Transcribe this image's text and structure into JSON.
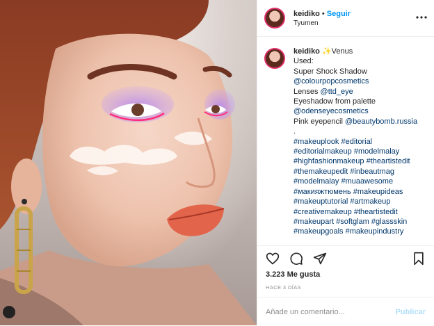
{
  "post": {
    "username": "keidiko",
    "dot": "•",
    "follow_label": "Seguir",
    "location": "Tyumen",
    "likes": "3.223 Me gusta",
    "time_ago": "HACE 3 DÍAS",
    "comment_placeholder": "Añade un comentario...",
    "publish_label": "Publicar"
  },
  "caption": {
    "username": "keidiko",
    "first_line_rest": "Venus",
    "lines": [
      "Used:",
      "Super Shock Shadow",
      "@colourpopcosmetics",
      "Lenses @ttd_eye",
      "Eyeshadow from palette",
      "@odenseyecosmetics",
      "Pink eyepencil @beautybomb.russia",
      ".",
      "#makeuplook #editorial",
      "#editorialmakeup #modelmalay",
      "#highfashionmakeup #theartistedit",
      "#themakeupedit #inbeautmag",
      "#modelmalay #muaawesome",
      "#макияжтюмень #makeupideas",
      "#makeuptutorial #artmakeup",
      "#creativemakeup #theartistedit",
      "#makeupart #softglam #glassskin",
      "#makeupgoals #makeupindustry"
    ]
  },
  "icons": {
    "avatar": "avatar",
    "sparkle": "sparkle-icon",
    "like": "heart-icon",
    "comment": "comment-icon",
    "share": "share-icon",
    "save": "bookmark-icon",
    "more": "more-icon"
  },
  "colors": {
    "link": "#00376b",
    "follow": "#0095f6",
    "muted": "#8e8e8e",
    "publish": "#b2dffc"
  }
}
